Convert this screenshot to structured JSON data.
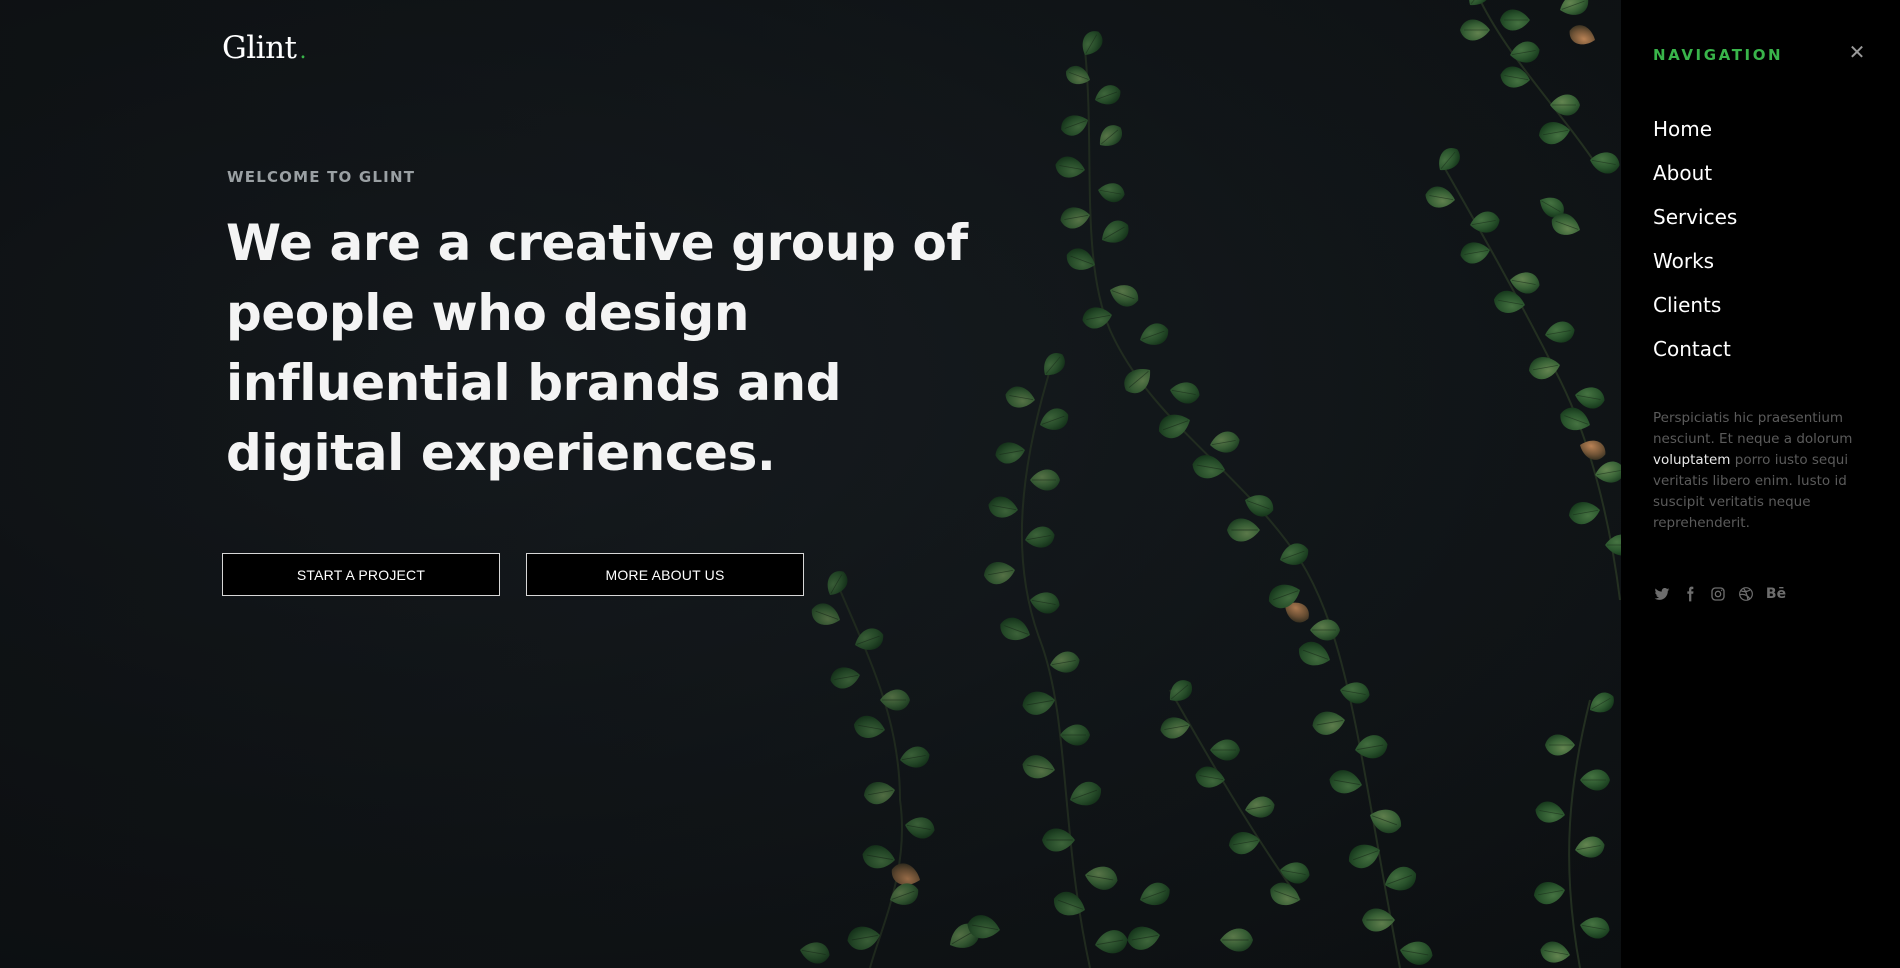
{
  "brand": {
    "name": "Glint",
    "dot": ".",
    "accent_color": "#39b54a"
  },
  "hero": {
    "eyebrow": "WELCOME TO GLINT",
    "headline": "We are a creative group of people who design influential brands and digital experiences.",
    "buttons": {
      "start_label": "START A PROJECT",
      "more_label": "MORE ABOUT US"
    }
  },
  "nav": {
    "title": "NAVIGATION",
    "close_icon": "close-icon",
    "items": [
      {
        "label": "Home"
      },
      {
        "label": "About"
      },
      {
        "label": "Services"
      },
      {
        "label": "Works"
      },
      {
        "label": "Clients"
      },
      {
        "label": "Contact"
      }
    ],
    "text_before": "Perspiciatis hic praesentium nesciunt. Et neque a dolorum ",
    "text_strong": "voluptatem",
    "text_after": " porro iusto sequi veritatis libero enim. Iusto id suscipit veritatis neque reprehenderit.",
    "socials": [
      {
        "name": "twitter-icon"
      },
      {
        "name": "facebook-icon"
      },
      {
        "name": "instagram-icon"
      },
      {
        "name": "dribbble-icon"
      },
      {
        "name": "behance-icon",
        "label": "Bē"
      }
    ]
  }
}
